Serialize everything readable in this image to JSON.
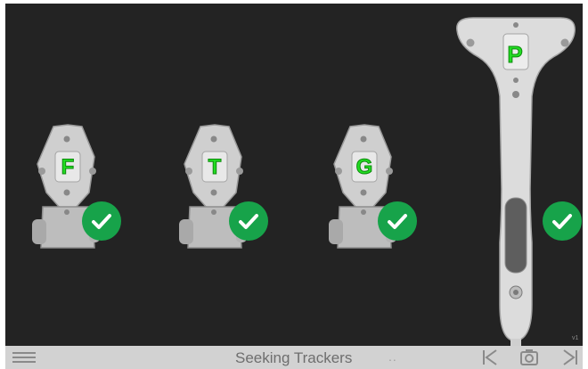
{
  "trackers": [
    {
      "letter": "F",
      "status": "ok"
    },
    {
      "letter": "T",
      "status": "ok"
    },
    {
      "letter": "G",
      "status": "ok"
    }
  ],
  "probe": {
    "letter": "P",
    "status": "ok"
  },
  "footer": {
    "status_text": "Seeking Trackers",
    "dots": "..",
    "version": "v1"
  },
  "colors": {
    "background": "#232323",
    "check": "#17a34a",
    "letter": "#22dd22",
    "footer": "#d2d2d2"
  },
  "icons": [
    "menu-icon",
    "previous-icon",
    "camera-icon",
    "next-icon",
    "check-icon"
  ]
}
